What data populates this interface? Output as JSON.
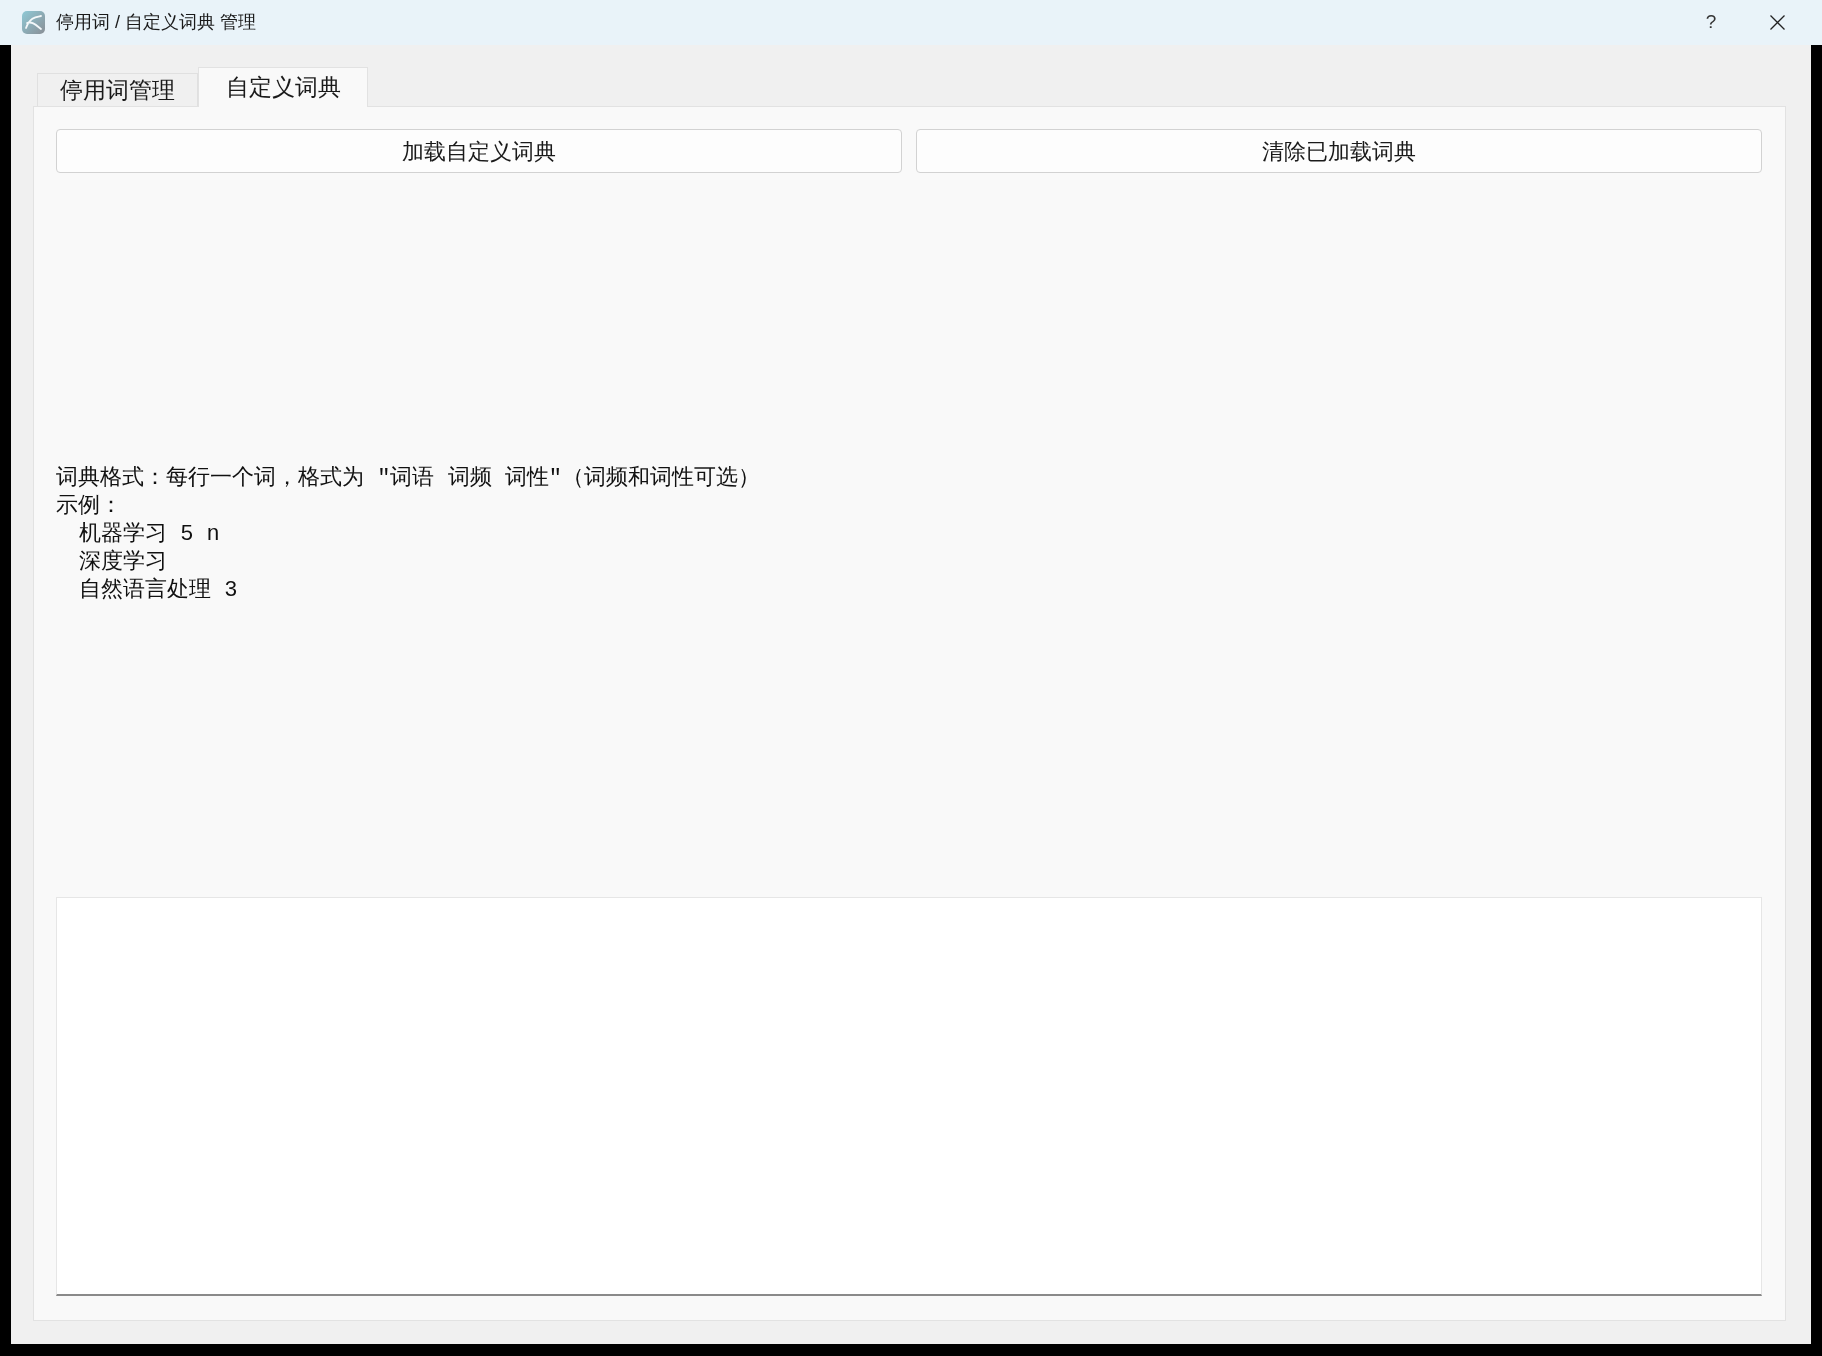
{
  "window": {
    "title": "停用词 / 自定义词典 管理",
    "help_label": "?"
  },
  "tabs": [
    {
      "label": "停用词管理",
      "selected": false
    },
    {
      "label": "自定义词典",
      "selected": true
    }
  ],
  "buttons": [
    {
      "label": "加载自定义词典"
    },
    {
      "label": "清除已加载词典"
    }
  ],
  "format_help": {
    "description": "词典格式：每行一个词，格式为 \"词语 词频 词性\"（词频和词性可选）",
    "example_heading": "示例：",
    "examples": [
      "机器学习 5 n",
      "深度学习",
      "自然语言处理 3"
    ]
  },
  "output_box": {
    "kind": "text_area"
  }
}
